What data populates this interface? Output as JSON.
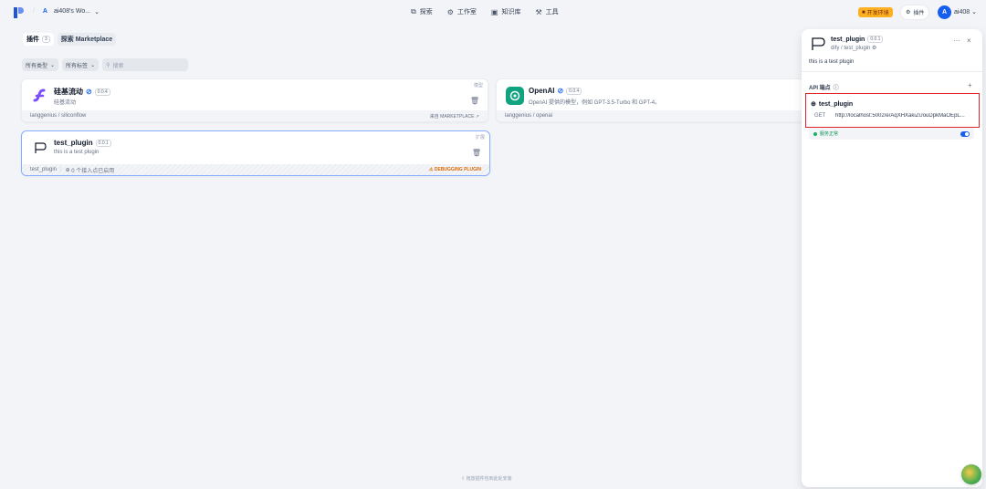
{
  "topbar": {
    "workspace_initial": "A",
    "workspace_name": "ai408's Wo...",
    "nav": [
      {
        "label": "探索",
        "icon": "explore-icon"
      },
      {
        "label": "工作室",
        "icon": "studio-icon"
      },
      {
        "label": "知识库",
        "icon": "knowledge-icon"
      },
      {
        "label": "工具",
        "icon": "tools-icon"
      }
    ],
    "env_badge": "开发环境",
    "plugins_button": "插件",
    "user_initial": "A",
    "user_name": "ai408"
  },
  "tabs": {
    "plugins_label": "插件",
    "plugins_count": "3",
    "marketplace_label": "探索 Marketplace"
  },
  "filters": {
    "category": "所有类型",
    "tags": "所有标签",
    "search_placeholder": "搜索"
  },
  "cards": [
    {
      "name": "硅基流动",
      "version": "0.0.4",
      "desc": "硅基流动",
      "type": "模型",
      "footer_left": "langgenius / siliconflow",
      "footer_right": "来自 MARKETPLACE"
    },
    {
      "name": "OpenAI",
      "version": "0.0.4",
      "desc": "OpenAI 提供的模型，例如 GPT-3.5-Turbo 和 GPT-4。",
      "type": "",
      "footer_left": "langgenius / openai",
      "footer_right": ""
    },
    {
      "name": "test_plugin",
      "version": "0.0.1",
      "desc": "this is a test plugin",
      "type": "扩展",
      "footer_left": "test_plugin",
      "footer_mid": "0 个接入点已启用",
      "footer_right": "DEBUGGING PLUGIN"
    }
  ],
  "hint": "拖放插件包到此处安装",
  "drawer": {
    "name": "test_plugin",
    "version": "0.0.1",
    "org": "dify / test_plugin",
    "desc": "this is a test plugin",
    "api_label": "API 端点",
    "endpoint_name": "test_plugin",
    "method": "GET",
    "url": "http://localhost:5002/e/AqXHXakiZUouDpkMaOEpL...",
    "status": "服务正常"
  },
  "colors": {
    "accent": "#155eef",
    "highlight_border": "#e0242a",
    "debug": "#dc6803",
    "ok": "#17b26a"
  }
}
